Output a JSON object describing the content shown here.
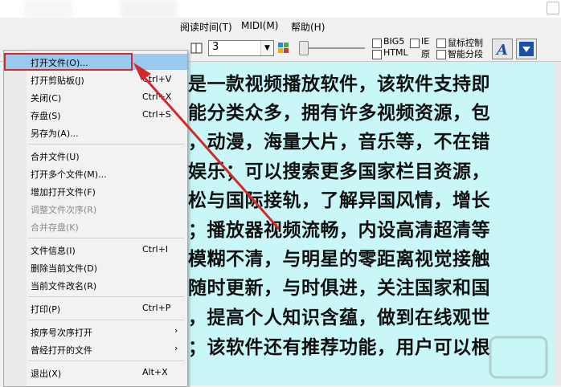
{
  "menubar": {
    "items": [
      "阅读时间(T)",
      "MIDI(M)",
      "帮助(H)"
    ]
  },
  "toolbar": {
    "font_size_value": "3",
    "checkboxes": [
      "BIG5",
      "IE",
      "鼠标控制",
      "HTML",
      "原",
      "智能分段"
    ]
  },
  "file_menu": {
    "items": [
      {
        "label": "打开文件(O)...",
        "shortcut": "",
        "submenu": false,
        "disabled": false,
        "highlighted": true
      },
      {
        "label": "打开剪贴板(J)",
        "shortcut": "Ctrl+V",
        "submenu": false,
        "disabled": false
      },
      {
        "label": "关闭(C)",
        "shortcut": "Ctrl+X",
        "submenu": false,
        "disabled": false
      },
      {
        "label": "存盘(S)",
        "shortcut": "Ctrl+S",
        "submenu": false,
        "disabled": false
      },
      {
        "label": "另存为(A)...",
        "shortcut": "",
        "submenu": false,
        "disabled": false
      },
      {
        "label": "合并文件(U)",
        "shortcut": "",
        "submenu": false,
        "disabled": false
      },
      {
        "label": "打开多个文件(M)...",
        "shortcut": "",
        "submenu": false,
        "disabled": false
      },
      {
        "label": "增加打开文件(F)",
        "shortcut": "",
        "submenu": false,
        "disabled": false
      },
      {
        "label": "调整文件次序(R)",
        "shortcut": "",
        "submenu": false,
        "disabled": true
      },
      {
        "label": "合并存盘(K)",
        "shortcut": "",
        "submenu": false,
        "disabled": true
      },
      {
        "label": "文件信息(I)",
        "shortcut": "Ctrl+I",
        "submenu": false,
        "disabled": false
      },
      {
        "label": "删除当前文件(D)",
        "shortcut": "",
        "submenu": false,
        "disabled": false
      },
      {
        "label": "当前文件改名(R)",
        "shortcut": "",
        "submenu": false,
        "disabled": false
      },
      {
        "label": "打印(P)",
        "shortcut": "Ctrl+P",
        "submenu": false,
        "disabled": false
      },
      {
        "label": "按序号次序打开",
        "shortcut": "",
        "submenu": true,
        "disabled": false
      },
      {
        "label": "曾经打开的文件",
        "shortcut": "",
        "submenu": true,
        "disabled": false
      },
      {
        "label": "退出(X)",
        "shortcut": "Alt+X",
        "submenu": false,
        "disabled": false
      }
    ]
  },
  "reader": {
    "lines": [
      "是一款视频播放软件，该软件支持即",
      "能分类众多，拥有许多视频资源，包",
      "，动漫，海量大片，音乐等，不在错",
      "娱乐；可以搜索更多国家栏目资源，",
      "松与国际接轨，了解异国风情，增长",
      "；播放器视频流畅，内设高清超清等",
      "模糊不清，与明星的零距离视觉接触",
      "随时更新，与时俱进，关注国家和国",
      "，提高个人知识含蕴，做到在线观世",
      "；该软件还有推荐功能，用户可以根"
    ]
  },
  "colors": {
    "reader_bg": "#c9f7f7",
    "highlight": "#99c9ef",
    "annotation_red": "#d22a2a"
  }
}
